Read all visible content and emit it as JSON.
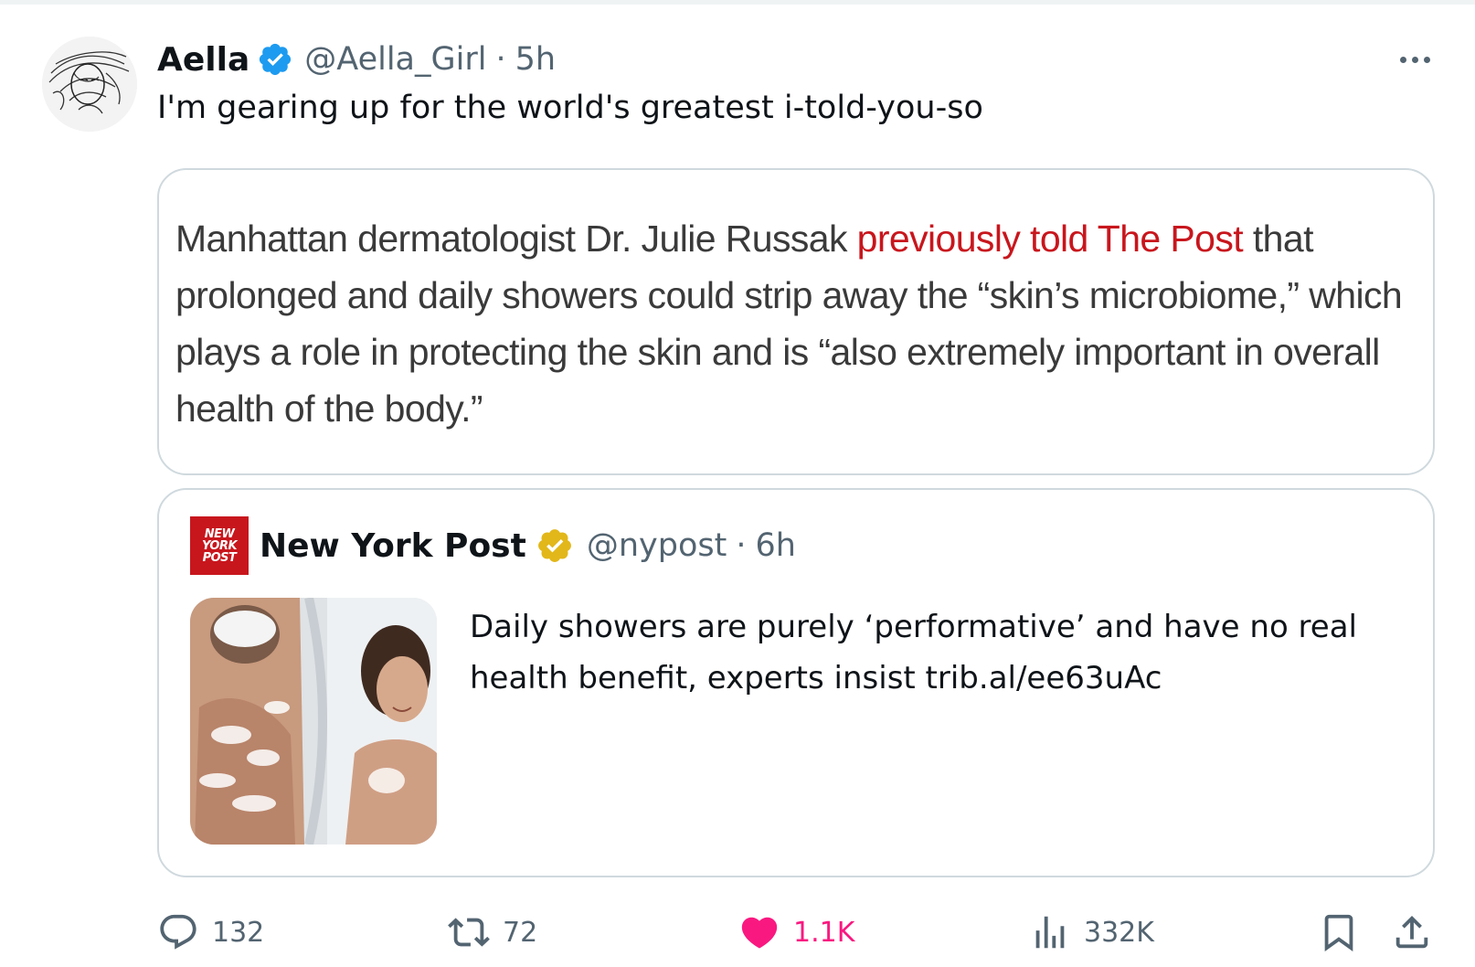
{
  "post": {
    "author_name": "Aella",
    "handle": "@Aella_Girl",
    "separator": "·",
    "time": "5h",
    "text": "I'm gearing up for the world's greatest i-told-you-so"
  },
  "media_quote": {
    "part1": "Manhattan dermatologist Dr. Julie Russak ",
    "link_text": "previously told The Post",
    "part2": " that prolonged and daily showers could strip away the “skin’s microbiome,” which plays a role in protecting the skin and is “also extremely important in overall health of the body.”"
  },
  "quoted_post": {
    "logo_lines": [
      "NEW",
      "YORK",
      "POST"
    ],
    "author_name": "New York Post",
    "handle": "@nypost",
    "separator": "·",
    "time": "6h",
    "text": "Daily showers are purely ‘performative’ and have no real health benefit, experts insist trib.al/ee63uAc"
  },
  "actions": {
    "replies": "132",
    "reposts": "72",
    "likes": "1.1K",
    "views": "332K"
  },
  "icons": {
    "verified": "verified-badge-icon",
    "gold_verified": "gold-verified-badge-icon",
    "more": "more-icon",
    "reply": "reply-icon",
    "repost": "repost-icon",
    "like": "like-icon",
    "views": "views-icon",
    "bookmark": "bookmark-icon",
    "share": "share-icon"
  },
  "colors": {
    "accent_blue": "#1d9bf0",
    "like_pink": "#f91880",
    "nypost_red": "#c8161d",
    "gold": "#e2b719",
    "secondary_text": "#536471"
  }
}
